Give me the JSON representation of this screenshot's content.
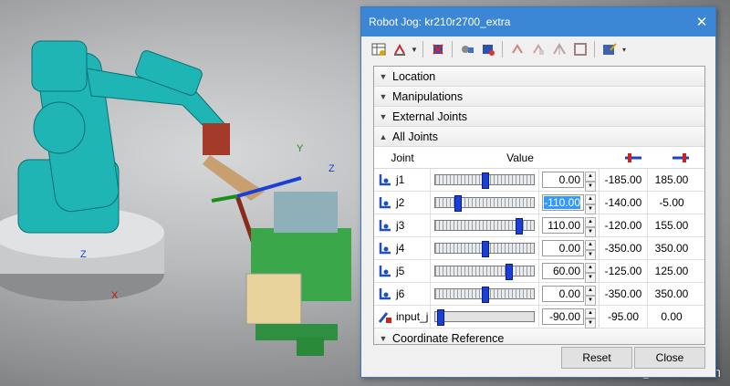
{
  "dialog": {
    "title": "Robot Jog: kr210r2700_extra",
    "close_glyph": "✕"
  },
  "toolbar": {
    "icons": [
      "table-icon",
      "home-pose-icon",
      "pose-dropdown-icon",
      "reset-joints-icon",
      "follow-mode-icon",
      "teach-pendant-icon",
      "copy-pose-icon",
      "paste-pose-icon",
      "mirror-icon",
      "frame-icon",
      "options-icon"
    ]
  },
  "sections": {
    "location": "Location",
    "manipulations": "Manipulations",
    "external_joints": "External Joints",
    "all_joints": "All Joints",
    "coordinate_reference": "Coordinate Reference"
  },
  "grid": {
    "joint_header": "Joint",
    "value_header": "Value",
    "min_icon": "lower-limit-icon",
    "max_icon": "upper-limit-icon"
  },
  "joints": [
    {
      "name": "j1",
      "value": "0.00",
      "min": "-185.00",
      "max": "185.00",
      "pos": 0.5,
      "selected": false
    },
    {
      "name": "j2",
      "value": "-110.00",
      "min": "-140.00",
      "max": "-5.00",
      "pos": 0.22,
      "selected": true
    },
    {
      "name": "j3",
      "value": "110.00",
      "min": "-120.00",
      "max": "155.00",
      "pos": 0.84,
      "selected": false
    },
    {
      "name": "j4",
      "value": "0.00",
      "min": "-350.00",
      "max": "350.00",
      "pos": 0.5,
      "selected": false
    },
    {
      "name": "j5",
      "value": "60.00",
      "min": "-125.00",
      "max": "125.00",
      "pos": 0.74,
      "selected": false
    },
    {
      "name": "j6",
      "value": "0.00",
      "min": "-350.00",
      "max": "350.00",
      "pos": 0.5,
      "selected": false
    },
    {
      "name": "input_j",
      "value": "-90.00",
      "min": "-95.00",
      "max": "0.00",
      "pos": 0.05,
      "selected": false
    }
  ],
  "buttons": {
    "reset": "Reset",
    "close": "Close"
  },
  "watermark": "CSDN@IndRobSim",
  "colors": {
    "robot": "#1fb5b5",
    "title_bar": "#3c86d6",
    "slider_thumb": "#1a3fd8"
  }
}
